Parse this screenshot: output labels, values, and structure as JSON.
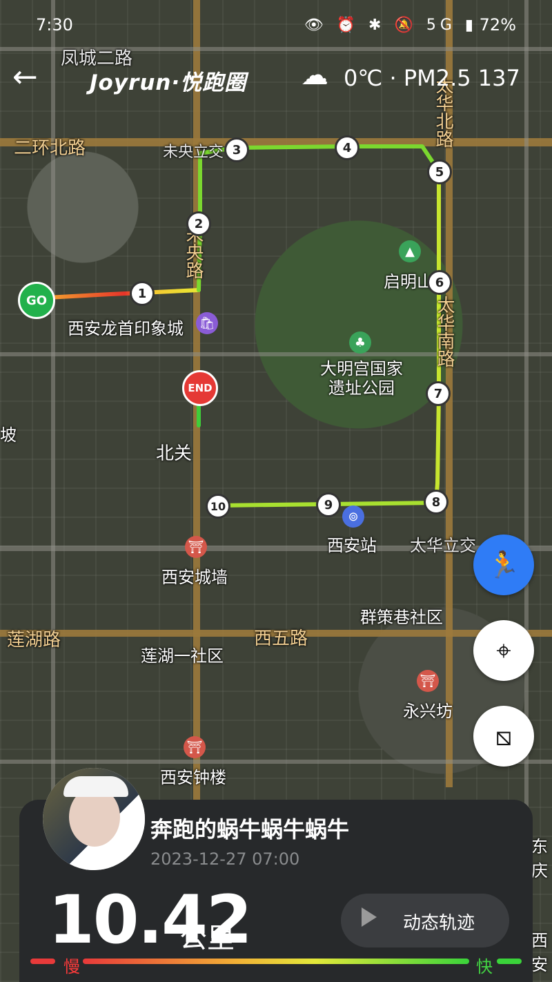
{
  "status": {
    "time": "7:30",
    "icons": "👁 ⏰ ✱ 🔕 5G ▮",
    "battery": "72%"
  },
  "header": {
    "back": "←",
    "brand": "Joyrun·悦跑圈",
    "cloud_icon": "cloud-icon",
    "weather": "0℃ · PM2.5 137"
  },
  "map": {
    "road_labels": [
      "凤城二路",
      "二环北路",
      "未央立交",
      "未央路",
      "太华北路",
      "太华南路",
      "太华立交",
      "莲湖路",
      "西五路"
    ],
    "places": [
      "西安龙首印象城",
      "启明山",
      "大明宫国家遗址公园",
      "北关",
      "西安站",
      "西安城墙",
      "群策巷社区",
      "莲湖一社区",
      "永兴坊",
      "西安钟楼",
      "坡",
      "东庆",
      "西安"
    ],
    "markers": [
      "1",
      "2",
      "3",
      "4",
      "5",
      "6",
      "7",
      "8",
      "9",
      "10"
    ],
    "start": "GO",
    "end": "END"
  },
  "panel": {
    "username": "奔跑的蜗牛蜗牛蜗牛",
    "date": "2023-12-27 07:00",
    "distance": "10.42",
    "unit": "公里",
    "replay": "动态轨迹",
    "slow": "慢",
    "fast": "快"
  }
}
